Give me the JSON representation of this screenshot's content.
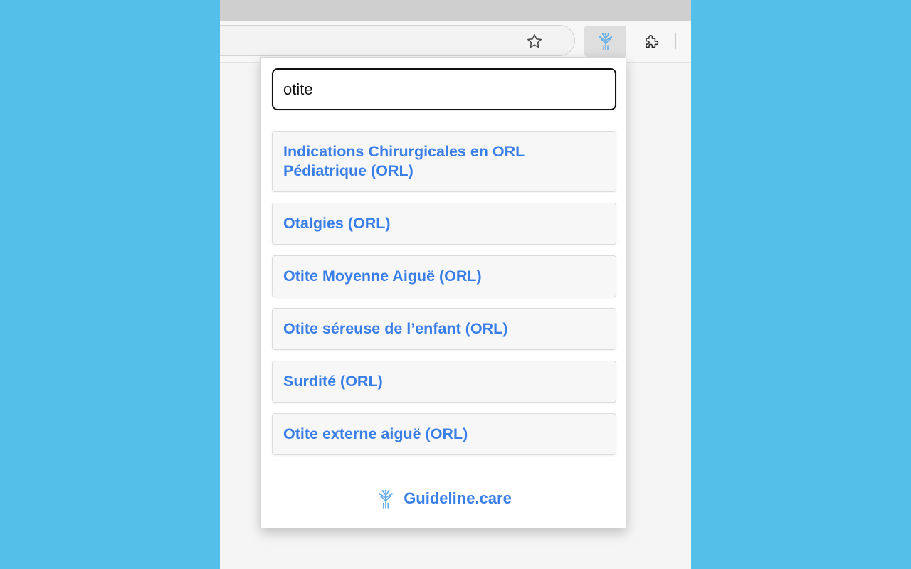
{
  "toolbar": {
    "bookmark_icon": "star-icon",
    "extension_icon": "guideline-logo-icon",
    "extensions_menu_icon": "puzzle-icon"
  },
  "popup": {
    "search": {
      "value": "otite"
    },
    "results": [
      "Indications Chirurgicales en ORL Pédiatrique (ORL)",
      "Otalgies (ORL)",
      "Otite Moyenne Aiguë (ORL)",
      "Otite séreuse de l’enfant (ORL)",
      "Surdité (ORL)",
      "Otite externe aiguë (ORL)"
    ],
    "footer": {
      "brand": "Guideline.care"
    }
  },
  "colors": {
    "background": "#52c0e8",
    "accent": "#3a7ee8",
    "logo": "#6aaee8"
  }
}
